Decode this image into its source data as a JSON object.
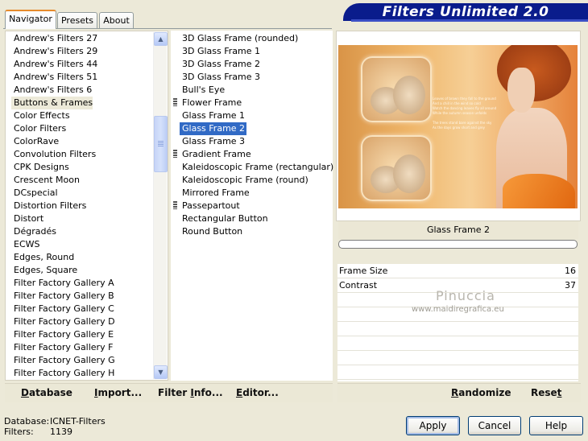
{
  "app": {
    "title": "Filters Unlimited 2.0"
  },
  "tabs": [
    {
      "label": "Navigator",
      "active": true
    },
    {
      "label": "Presets",
      "active": false
    },
    {
      "label": "About",
      "active": false
    }
  ],
  "categories": {
    "items": [
      "Andrew's Filters 27",
      "Andrew's Filters 29",
      "Andrew's Filters 44",
      "Andrew's Filters 51",
      "Andrew's Filters 6",
      "Buttons & Frames",
      "Color Effects",
      "Color Filters",
      "ColorRave",
      "Convolution Filters",
      "CPK Designs",
      "Crescent Moon",
      "DCspecial",
      "Distortion Filters",
      "Distort",
      "Dégradés",
      "ECWS",
      "Edges, Round",
      "Edges, Square",
      "Filter Factory Gallery A",
      "Filter Factory Gallery B",
      "Filter Factory Gallery C",
      "Filter Factory Gallery D",
      "Filter Factory Gallery E",
      "Filter Factory Gallery F",
      "Filter Factory Gallery G",
      "Filter Factory Gallery H"
    ],
    "selected": "Buttons & Frames"
  },
  "filters": {
    "items": [
      {
        "label": "3D Glass Frame (rounded)",
        "marker": false
      },
      {
        "label": "3D Glass Frame 1",
        "marker": false
      },
      {
        "label": "3D Glass Frame 2",
        "marker": false
      },
      {
        "label": "3D Glass Frame 3",
        "marker": false
      },
      {
        "label": "Bull's Eye",
        "marker": false
      },
      {
        "label": "Flower Frame",
        "marker": true
      },
      {
        "label": "Glass Frame 1",
        "marker": false
      },
      {
        "label": "Glass Frame 2",
        "marker": false
      },
      {
        "label": "Glass Frame 3",
        "marker": false
      },
      {
        "label": "Gradient Frame",
        "marker": true
      },
      {
        "label": "Kaleidoscopic Frame (rectangular)",
        "marker": false
      },
      {
        "label": "Kaleidoscopic Frame (round)",
        "marker": false
      },
      {
        "label": "Mirrored Frame",
        "marker": false
      },
      {
        "label": "Passepartout",
        "marker": true
      },
      {
        "label": "Rectangular Button",
        "marker": false
      },
      {
        "label": "Round Button",
        "marker": false
      }
    ],
    "selected": "Glass Frame 2"
  },
  "preview": {
    "poem_lines": [
      "Leaves of brown they fall to the ground",
      "And a chill in the wind so cold",
      "Watch the dancing leaves fly all around",
      "While the autumn season unfolds",
      "",
      "The trees stand bare against the sky",
      "As the days grow short and grey"
    ]
  },
  "filter_name": "Glass Frame 2",
  "params": [
    {
      "label": "Frame Size",
      "value": "16"
    },
    {
      "label": "Contrast",
      "value": "37"
    }
  ],
  "watermark": {
    "name": "Pinuccia",
    "url": "www.maidiregrafica.eu"
  },
  "left_toolbar": {
    "database": {
      "u": "D",
      "rest": "atabase"
    },
    "import": {
      "u": "I",
      "rest": "mport..."
    },
    "filter_info": {
      "pre": "Filter ",
      "u": "I",
      "rest": "nfo..."
    },
    "editor": {
      "u": "E",
      "rest": "ditor..."
    }
  },
  "right_toolbar": {
    "randomize": {
      "u": "R",
      "rest": "andomize"
    },
    "reset": {
      "pre": "Rese",
      "u": "t",
      "rest": ""
    }
  },
  "status": {
    "database_label": "Database:",
    "database_value": "ICNET-Filters",
    "filters_label": "Filters:",
    "filters_value": "1139"
  },
  "buttons": {
    "apply": "Apply",
    "cancel": "Cancel",
    "help": "Help"
  },
  "colors": {
    "accent": "#0a1c8c",
    "selection": "#316ac5",
    "tab_highlight": "#e68b2c"
  }
}
